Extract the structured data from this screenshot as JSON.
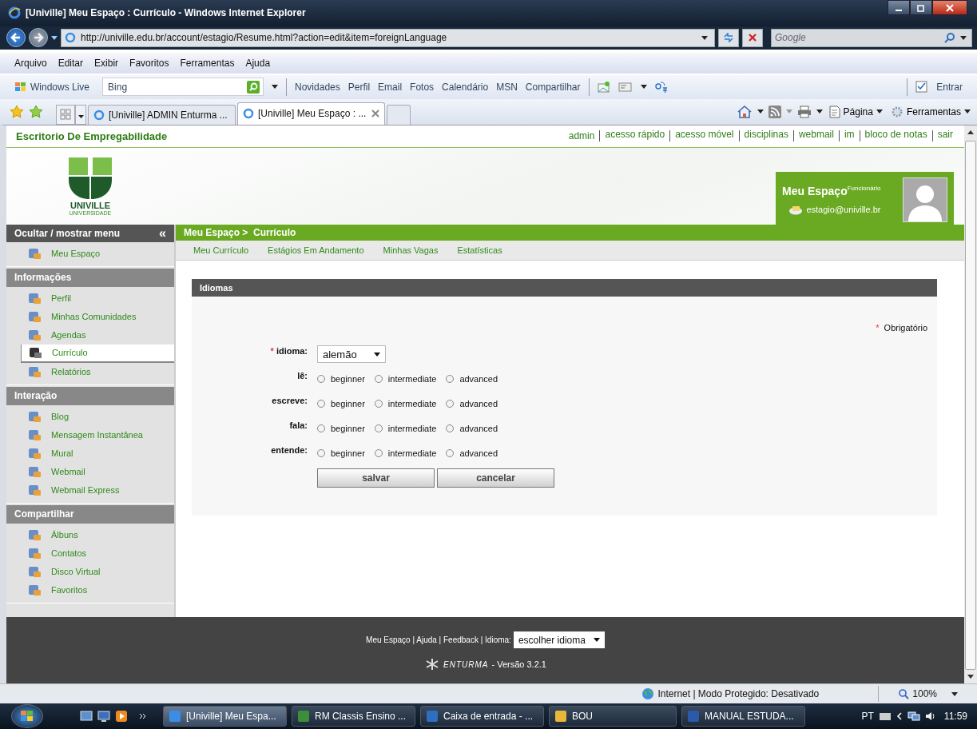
{
  "browser": {
    "title": "[Univille] Meu Espaço : Currículo - Windows Internet Explorer",
    "url": "http://univille.edu.br/account/estagio/Resume.html?action=edit&item=foreignLanguage",
    "search_placeholder": "Google",
    "menu": [
      "Arquivo",
      "Editar",
      "Exibir",
      "Favoritos",
      "Ferramentas",
      "Ajuda"
    ],
    "live_toolbar": {
      "brand": "Windows Live",
      "search_value": "Bing",
      "links": [
        "Novidades",
        "Perfil",
        "Email",
        "Fotos",
        "Calendário",
        "MSN",
        "Compartilhar"
      ],
      "signin": "Entrar"
    },
    "tabs": [
      {
        "label": "[Univille] ADMIN Enturma ...",
        "selected": false
      },
      {
        "label": "[Univille] Meu Espaço : ...",
        "selected": true
      }
    ],
    "commands": [
      "Página",
      "Ferramentas"
    ]
  },
  "page": {
    "site_title": "Escritorio De Empregabilidade",
    "top_links": [
      "admin",
      "acesso rápido",
      "acesso móvel",
      "disciplinas",
      "webmail",
      "im",
      "bloco de notas",
      "sair"
    ],
    "logo": {
      "name": "UNIVILLE",
      "sub": "UNIVERSIDADE"
    },
    "user_box": {
      "title": "Meu Espaço",
      "role": "Funcionário",
      "email": "estagio@univille.br"
    },
    "sidebar": {
      "toggle": "Ocultar / mostrar menu",
      "toggle_icon": "«",
      "sections": [
        {
          "items": [
            {
              "label": "Meu Espaço",
              "selected": false
            }
          ]
        },
        {
          "title": "Informações",
          "items": [
            {
              "label": "Perfil",
              "selected": false
            },
            {
              "label": "Minhas Comunidades",
              "selected": false
            },
            {
              "label": "Agendas",
              "selected": false
            },
            {
              "label": "Currículo",
              "selected": true
            },
            {
              "label": "Relatórios",
              "selected": false
            }
          ]
        },
        {
          "title": "Interação",
          "items": [
            {
              "label": "Blog",
              "selected": false
            },
            {
              "label": "Mensagem Instantânea",
              "selected": false
            },
            {
              "label": "Mural",
              "selected": false
            },
            {
              "label": "Webmail",
              "selected": false
            },
            {
              "label": "Webmail Express",
              "selected": false
            }
          ]
        },
        {
          "title": "Compartilhar",
          "items": [
            {
              "label": "Álbuns",
              "selected": false
            },
            {
              "label": "Contatos",
              "selected": false
            },
            {
              "label": "Disco Virtual",
              "selected": false
            },
            {
              "label": "Favoritos",
              "selected": false
            }
          ]
        }
      ]
    },
    "breadcrumb": "Meu Espaço >  Currículo",
    "subnav": [
      "Meu Currículo",
      "Estágios Em Andamento",
      "Minhas Vagas",
      "Estatísticas"
    ],
    "panel": {
      "title": "Idiomas",
      "required_mark": "*",
      "required_note": "Obrigatório",
      "select": {
        "label": "idioma:",
        "required": true,
        "value": "alemão"
      },
      "skills": [
        {
          "label": "lê:",
          "options": [
            {
              "label": "beginner",
              "selected": false
            },
            {
              "label": "intermediate",
              "selected": false
            },
            {
              "label": "advanced",
              "selected": false
            }
          ]
        },
        {
          "label": "escreve:",
          "options": [
            {
              "label": "beginner",
              "selected": false
            },
            {
              "label": "intermediate",
              "selected": false
            },
            {
              "label": "advanced",
              "selected": false
            }
          ]
        },
        {
          "label": "fala:",
          "options": [
            {
              "label": "beginner",
              "selected": false
            },
            {
              "label": "intermediate",
              "selected": false
            },
            {
              "label": "advanced",
              "selected": false
            }
          ]
        },
        {
          "label": "entende:",
          "options": [
            {
              "label": "beginner",
              "selected": false
            },
            {
              "label": "intermediate",
              "selected": false
            },
            {
              "label": "advanced",
              "selected": false
            }
          ]
        }
      ],
      "buttons": [
        "salvar",
        "cancelar"
      ]
    },
    "footer": {
      "links": "Meu Espaço | Ajuda | Feedback | Idioma:",
      "language_select": "escolher idioma",
      "brand": "ENTURMA",
      "version": "- Versão 3.2.1"
    }
  },
  "status_bar": {
    "zone": "Internet | Modo Protegido: Desativado",
    "zoom": "100%"
  },
  "taskbar": {
    "items": [
      {
        "label": "[Univille] Meu Espa...",
        "selected": true
      },
      {
        "label": "RM Classis Ensino ...",
        "selected": false
      },
      {
        "label": "Caixa de entrada - ...",
        "selected": false
      },
      {
        "label": "BOU",
        "selected": false
      },
      {
        "label": "MANUAL ESTUDA...",
        "selected": false
      }
    ],
    "language": "PT",
    "time": "11:59"
  }
}
